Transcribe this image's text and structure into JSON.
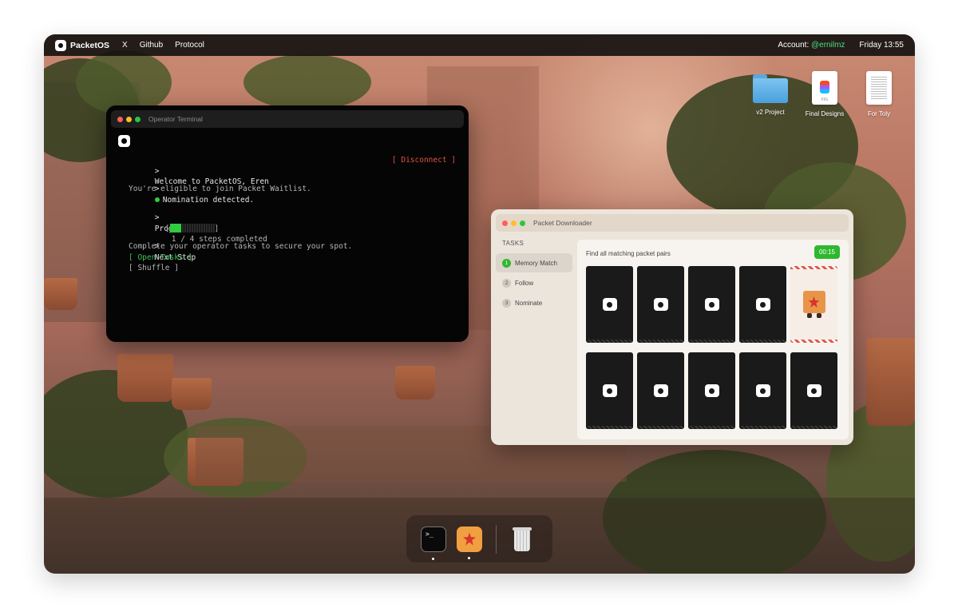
{
  "menubar": {
    "brand": "PacketOS",
    "links": [
      "X",
      "Github",
      "Protocol"
    ],
    "account_label": "Account:",
    "account_handle": "@ernilmz",
    "clock": "Friday 13:55"
  },
  "desktop_icons": [
    {
      "label": "v2 Project",
      "icon": "folder-icon"
    },
    {
      "label": "Final Designs",
      "icon": "figma-file-icon",
      "badge": "FIG"
    },
    {
      "label": "For Toly",
      "icon": "document-icon"
    }
  ],
  "terminal": {
    "title": "Operator Terminal",
    "prompt": ">",
    "welcome": "Welcome to PacketOS, Eren",
    "disconnect": "[ Disconnect ]",
    "nomination_title": "Nomination detected.",
    "nomination_text": "You're eligible to join Packet Waitlist.",
    "progress_title": "Progress",
    "progress_bracket_open": "[",
    "progress_bracket_close": "]",
    "progress_fraction": 0.25,
    "progress_text": "1 / 4 steps completed",
    "next_title": "Next Step",
    "next_text": "Complete your operator tasks to secure your spot.",
    "open_tasks": "[ Open Tasks ]",
    "shuffle": "[ Shuffle ]"
  },
  "downloader": {
    "title": "Packet Downloader",
    "tasks_header": "TASKS",
    "tasks": [
      {
        "num": "1",
        "label": "Memory Match",
        "active": true
      },
      {
        "num": "2",
        "label": "Follow",
        "active": false
      },
      {
        "num": "3",
        "label": "Nominate",
        "active": false
      }
    ],
    "game_instruction": "Find all matching packet pairs",
    "timer": "00:15",
    "cards": [
      "face-down",
      "face-down",
      "face-down",
      "face-down",
      "revealed",
      "face-down",
      "face-down",
      "face-down",
      "face-down",
      "face-down"
    ]
  },
  "dock": {
    "terminal_glyph": ">_",
    "items": [
      "terminal-app-icon",
      "packet-downloader-app-icon",
      "trash-icon"
    ]
  },
  "colors": {
    "accent_green": "#2eb82e",
    "terminal_red": "#e0523f",
    "terminal_bg": "#050505",
    "window_bg": "#ece5dc"
  }
}
